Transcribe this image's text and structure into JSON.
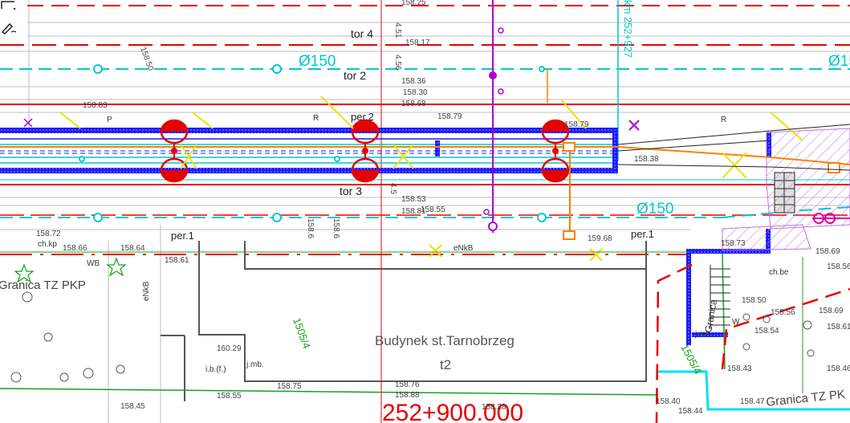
{
  "drawing": {
    "tracks": {
      "tor4": "tor 4",
      "tor2": "tor 2",
      "tor3": "tor 3",
      "per2": "per.2",
      "per1_left": "per.1",
      "per1_right": "per.1"
    },
    "pipes": {
      "left": "Ø150",
      "bottom": "Ø150"
    },
    "building": {
      "name": "Budynek st.Tarnobrzeg",
      "sub": "t2"
    },
    "chainage": "252+900.000",
    "km_note": "km 252+927",
    "boundary_left": "Granica TZ PKP",
    "boundary_right": "Granica TZ PK",
    "parcel_a": "1505/4",
    "parcel_b": "1505/4",
    "marks": {
      "R1": "R",
      "R2": "R",
      "P": "P",
      "eNkB_h": "eNkB",
      "eNkB_v": "eNkB",
      "jmb1": "j.mb.",
      "jmb2": "j.mb.",
      "ibf": "i.b.(f.)",
      "chkp": "ch.kp",
      "chbe": "ch.be",
      "W": "W",
      "Wb": "WB",
      "granica_v": "Granica"
    },
    "elevations": {
      "e1": "158.25",
      "e2": "158.17",
      "e3": "158.36",
      "e4": "158.30",
      "e5": "158.68",
      "e6": "158.83",
      "e7": "158.79",
      "e8": "158.79",
      "e9": "158.53",
      "e10": "158.81",
      "e11": "158.55",
      "e12": "158.72",
      "e13": "158.66",
      "e14": "158.64",
      "e15": "158.61",
      "e16": "159.68",
      "e17": "158.73",
      "e18": "158.56",
      "e19": "158.50",
      "e20": "158.56",
      "e21": "158.69",
      "e22": "158.61",
      "e23": "158.54",
      "e24": "158.46",
      "e25": "158.43",
      "e26": "160.29",
      "e27": "158.45",
      "e28": "158.55",
      "e29": "158.75",
      "e30": "158.76",
      "e31": "158.88",
      "e32": "158.38",
      "e33": "158.40",
      "e34": "158.44",
      "e35": "158.47",
      "e36": "158.38",
      "e37": "158.69",
      "e38": "4.51",
      "e39": "4.56",
      "e40": "4.5",
      "e41": "158.6",
      "e42": "158.6",
      "e43": "158.50"
    }
  },
  "toolbar": {
    "tool1_icon": "line-tool-icon",
    "tool2_icon": "pen-tool-icon"
  },
  "colors": {
    "red": "#e60000",
    "blue": "#1a1aff",
    "cyan": "#00c8d2",
    "orange": "#ff8000",
    "magenta": "#b000d0",
    "yellow": "#f0e000",
    "green": "#1aa01a"
  }
}
